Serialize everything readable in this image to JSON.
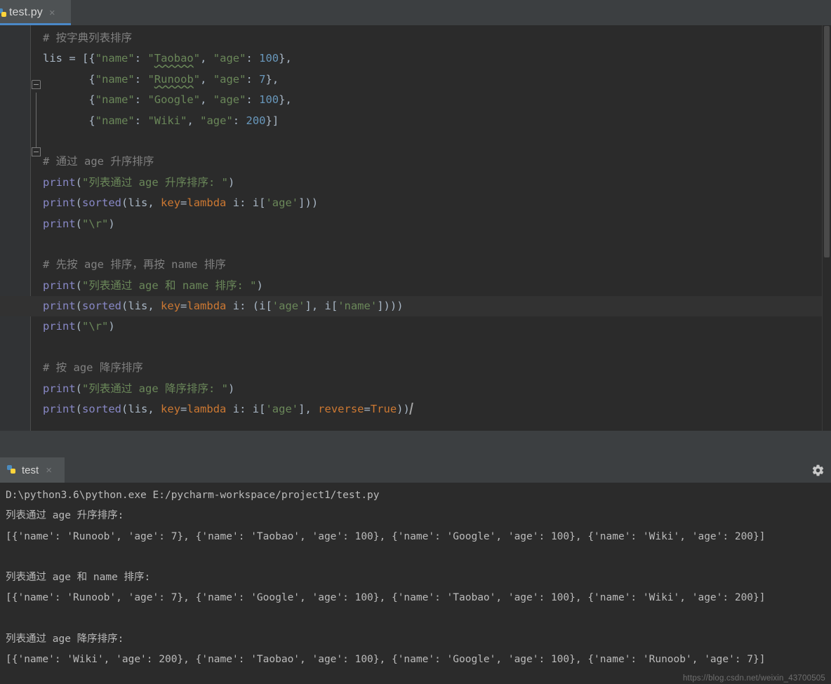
{
  "editor_tab": {
    "filename": "test.py",
    "close_label": "×",
    "icon": "python-file-icon"
  },
  "code": {
    "lines": [
      {
        "id": "l1",
        "type": "comment",
        "text": "# 按字典列表排序"
      },
      {
        "id": "l2",
        "type": "code",
        "text": "lis = [{\"name\": \"Taobao\", \"age\": 100},"
      },
      {
        "id": "l3",
        "type": "code",
        "text": "       {\"name\": \"Runoob\", \"age\": 7},"
      },
      {
        "id": "l4",
        "type": "code",
        "text": "       {\"name\": \"Google\", \"age\": 100},"
      },
      {
        "id": "l5",
        "type": "code",
        "text": "       {\"name\": \"Wiki\", \"age\": 200}]"
      },
      {
        "id": "l6",
        "type": "blank",
        "text": ""
      },
      {
        "id": "l7",
        "type": "comment",
        "text": "# 通过 age 升序排序"
      },
      {
        "id": "l8",
        "type": "code",
        "text": "print(\"列表通过 age 升序排序: \")"
      },
      {
        "id": "l9",
        "type": "code",
        "text": "print(sorted(lis, key=lambda i: i['age']))"
      },
      {
        "id": "l10",
        "type": "code",
        "text": "print(\"\\r\")"
      },
      {
        "id": "l11",
        "type": "blank",
        "text": ""
      },
      {
        "id": "l12",
        "type": "comment",
        "text": "# 先按 age 排序，再按 name 排序"
      },
      {
        "id": "l13",
        "type": "code",
        "text": "print(\"列表通过 age 和 name 排序: \")"
      },
      {
        "id": "l14",
        "type": "code",
        "text": "print(sorted(lis, key=lambda i: (i['age'], i['name'])))"
      },
      {
        "id": "l15",
        "type": "code",
        "text": "print(\"\\r\")"
      },
      {
        "id": "l16",
        "type": "blank",
        "text": ""
      },
      {
        "id": "l17",
        "type": "comment",
        "text": "# 按 age 降序排序"
      },
      {
        "id": "l18",
        "type": "code",
        "text": "print(\"列表通过 age 降序排序: \")"
      },
      {
        "id": "l19",
        "type": "code",
        "text": "print(sorted(lis, key=lambda i: i['age'], reverse=True))"
      }
    ],
    "highlighted_line_id": "l14",
    "colors": {
      "background": "#2b2b2b",
      "current_line_background": "#323232",
      "gutter": "#313335",
      "default_text": "#a9b7c6",
      "comment": "#808080",
      "keyword": "#cc7832",
      "string": "#6a8759",
      "number": "#6897bb",
      "function": "#8888c6"
    },
    "spell_warnings": [
      "Taobao",
      "Runoob"
    ]
  },
  "console_tab": {
    "label": "test",
    "close_label": "×",
    "icon": "python-run-icon",
    "settings_icon": "gear-icon"
  },
  "console": {
    "lines": [
      "D:\\python3.6\\python.exe E:/pycharm-workspace/project1/test.py",
      "列表通过 age 升序排序:",
      "[{'name': 'Runoob', 'age': 7}, {'name': 'Taobao', 'age': 100}, {'name': 'Google', 'age': 100}, {'name': 'Wiki', 'age': 200}]",
      "",
      "列表通过 age 和 name 排序:",
      "[{'name': 'Runoob', 'age': 7}, {'name': 'Google', 'age': 100}, {'name': 'Taobao', 'age': 100}, {'name': 'Wiki', 'age': 200}]",
      "",
      "列表通过 age 降序排序:",
      "[{'name': 'Wiki', 'age': 200}, {'name': 'Taobao', 'age': 100}, {'name': 'Google', 'age': 100}, {'name': 'Runoob', 'age': 7}]"
    ],
    "text_color": "#bbbbbb"
  },
  "watermark": {
    "text": "https://blog.csdn.net/weixin_43700505"
  }
}
